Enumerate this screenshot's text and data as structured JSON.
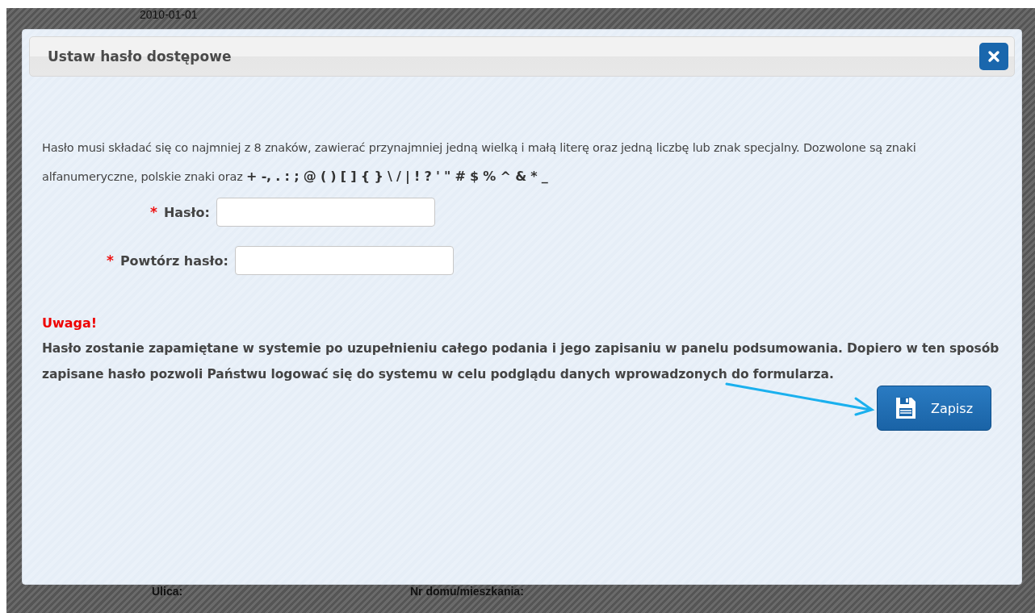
{
  "background": {
    "texts": [
      {
        "kind": "top",
        "text": "2010-01-01"
      },
      {
        "kind": "bottom-left",
        "text": "Ulica:"
      },
      {
        "kind": "bottom-right",
        "text": "Nr domu/mieszkania:"
      }
    ]
  },
  "dialog": {
    "title": "Ustaw hasło dostępowe",
    "rules": {
      "text": "Hasło musi składać się co najmniej z 8 znaków, zawierać przynajmniej jedną wielką i małą literę oraz jedną liczbę lub znak specjalny. Dozwolone są znaki alfanumeryczne, polskie znaki oraz",
      "allowed_chars": "+ -, . : ; @ ( ) [ ] { } \\ / | ! ? ' \" # $ % ^ & * _"
    },
    "fields": [
      {
        "required_mark": "*",
        "label": "Hasło:",
        "kind": "short"
      },
      {
        "required_mark": "*",
        "label": "Powtórz hasło:",
        "kind": "long"
      }
    ],
    "warning": {
      "title": "Uwaga!",
      "text": "Hasło zostanie zapamiętane w systemie po uzupełnieniu całego podania i jego zapisaniu w panelu podsumowania. Dopiero w ten sposób zapisane hasło pozwoli Państwu logować się do systemu w celu podglądu danych wprowadzonych do formularza."
    },
    "save_button": {
      "label": "Zapisz"
    }
  }
}
